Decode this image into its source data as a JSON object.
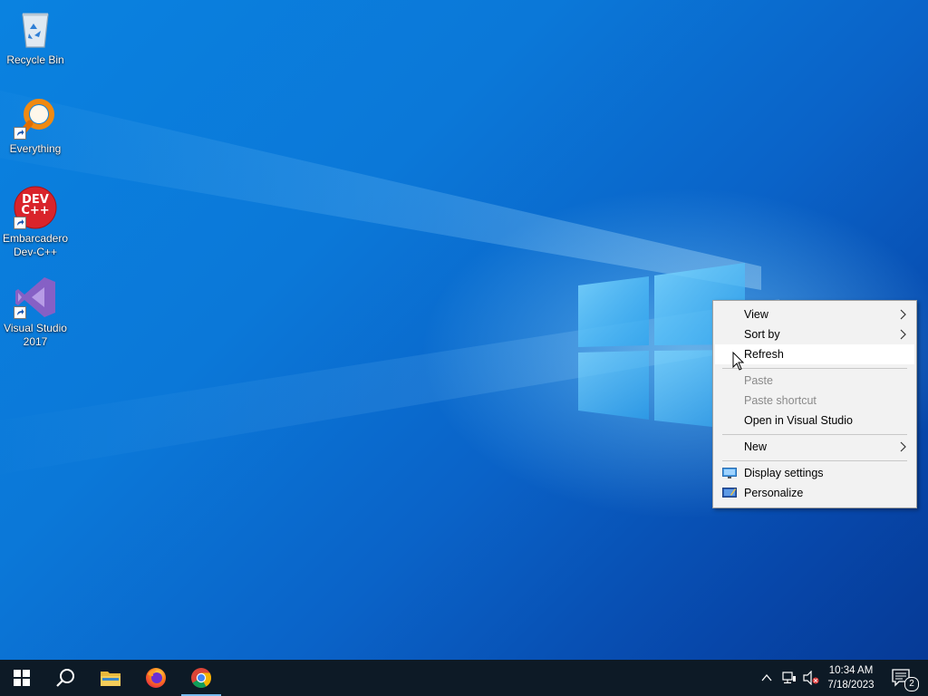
{
  "desktop": {
    "icons": [
      {
        "label": "Recycle Bin",
        "icon": "recycle-bin-icon"
      },
      {
        "label": "Everything",
        "icon": "everything-search-icon"
      },
      {
        "label": "Embarcadero Dev-C++",
        "icon": "dev-cpp-icon"
      },
      {
        "label": "Visual Studio 2017",
        "icon": "visual-studio-icon"
      }
    ],
    "devcpp_logo_text": "DEV C++"
  },
  "context_menu": {
    "items": [
      {
        "label": "View",
        "submenu": true,
        "enabled": true
      },
      {
        "label": "Sort by",
        "submenu": true,
        "enabled": true
      },
      {
        "label": "Refresh",
        "enabled": true,
        "hovered": true
      },
      {
        "label": "Paste",
        "enabled": false
      },
      {
        "label": "Paste shortcut",
        "enabled": false
      },
      {
        "label": "Open in Visual Studio",
        "enabled": true
      },
      {
        "label": "New",
        "submenu": true,
        "enabled": true
      },
      {
        "label": "Display settings",
        "icon": "display-settings-icon",
        "enabled": true
      },
      {
        "label": "Personalize",
        "icon": "personalize-icon",
        "enabled": true
      }
    ]
  },
  "taskbar": {
    "pinned": [
      {
        "name": "start",
        "icon": "windows-start-icon"
      },
      {
        "name": "search",
        "icon": "search-icon"
      },
      {
        "name": "file-explorer",
        "icon": "folder-icon"
      },
      {
        "name": "firefox",
        "icon": "firefox-icon"
      },
      {
        "name": "chrome",
        "icon": "chrome-icon",
        "active": true
      }
    ],
    "tray": {
      "icons": [
        "chevron-up-icon",
        "network-icon",
        "volume-muted-icon"
      ],
      "time": "10:34 AM",
      "date": "7/18/2023",
      "notification_count": "2"
    }
  },
  "colors": {
    "taskbar_bg": "#0d1a26",
    "menu_bg": "#f2f2f2",
    "menu_hover": "#ffffff",
    "disabled_text": "#8a8a8a",
    "accent": "#76b9ed"
  }
}
